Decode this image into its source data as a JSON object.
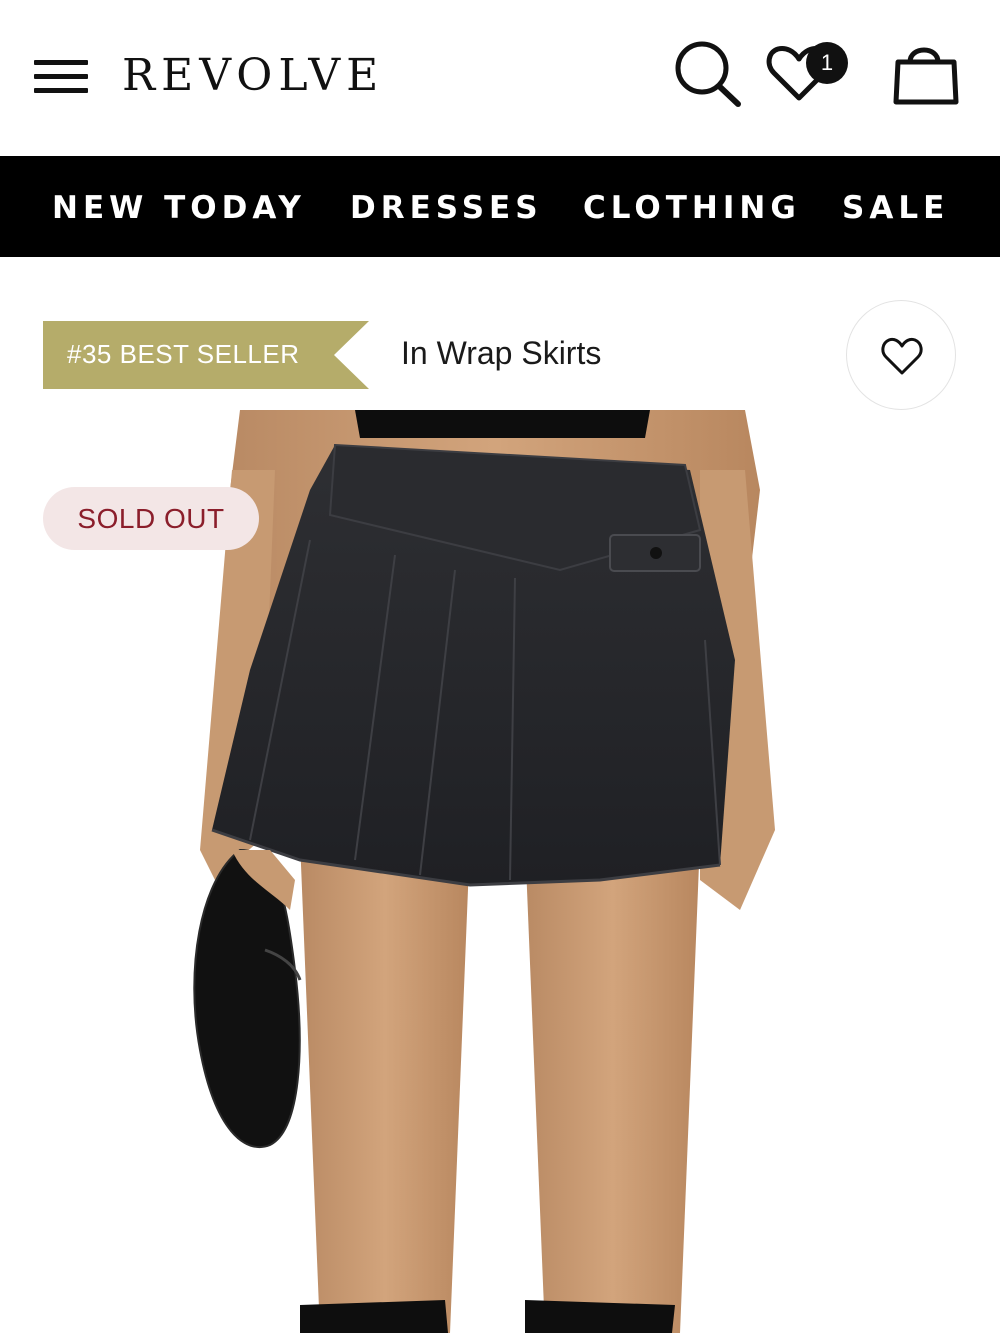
{
  "header": {
    "logo": "REVOLVE",
    "wishlist_count": "1"
  },
  "nav": {
    "items": [
      "NEW TODAY",
      "DRESSES",
      "CLOTHING",
      "SALE"
    ]
  },
  "product": {
    "best_seller_label": "#35 BEST SELLER",
    "category_label": "In Wrap Skirts",
    "status_badge": "SOLD OUT"
  },
  "colors": {
    "ribbon": "#b5ac6a",
    "nav_bg": "#000000",
    "soldout_bg": "#f3e6e6",
    "soldout_text": "#8b1e2b"
  }
}
